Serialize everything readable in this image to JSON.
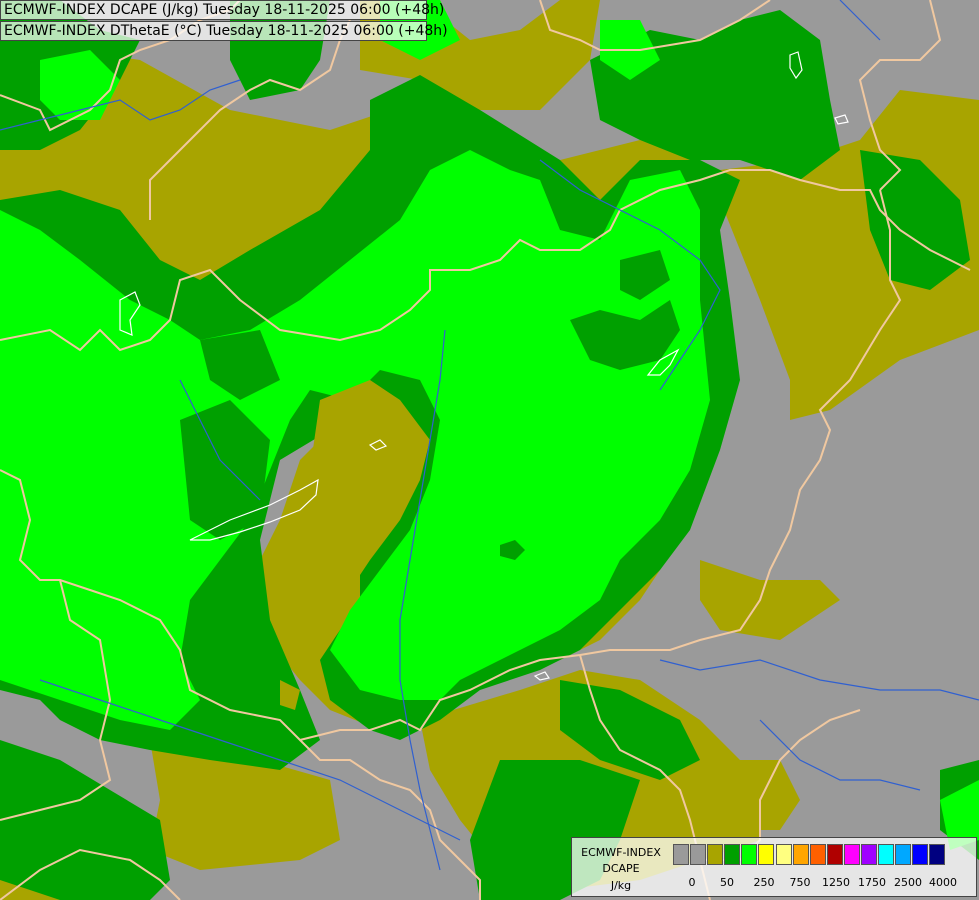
{
  "titles": {
    "line1": "ECMWF-INDEX DCAPE (J/kg) Tuesday 18-11-2025 06:00 (+48h)",
    "line2": "ECMWF-INDEX DThetaE (°C) Tuesday 18-11-2025 06:00 (+48h)"
  },
  "legend": {
    "title_line1": "ECMWF-INDEX",
    "title_line2": "DCAPE",
    "unit": "J/kg",
    "colors": [
      "#9a9a9a",
      "#9a9a9a",
      "#a8a400",
      "#00a000",
      "#00ff00",
      "#ffff00",
      "#ffff80",
      "#ffa500",
      "#ff6000",
      "#b00000",
      "#ff00ff",
      "#a000ff",
      "#00ffff",
      "#00a8ff",
      "#0000ff",
      "#000080"
    ],
    "ticks": [
      "0",
      "50",
      "250",
      "750",
      "1250",
      "1750",
      "2500",
      "4000"
    ]
  },
  "map_colors": {
    "grey": "#9a9a9a",
    "olive": "#a8a400",
    "dark_green": "#00a000",
    "bright_green": "#00ff00",
    "border": "#f0c8a0",
    "river": "#3060d0",
    "lake": "#ffffff"
  }
}
